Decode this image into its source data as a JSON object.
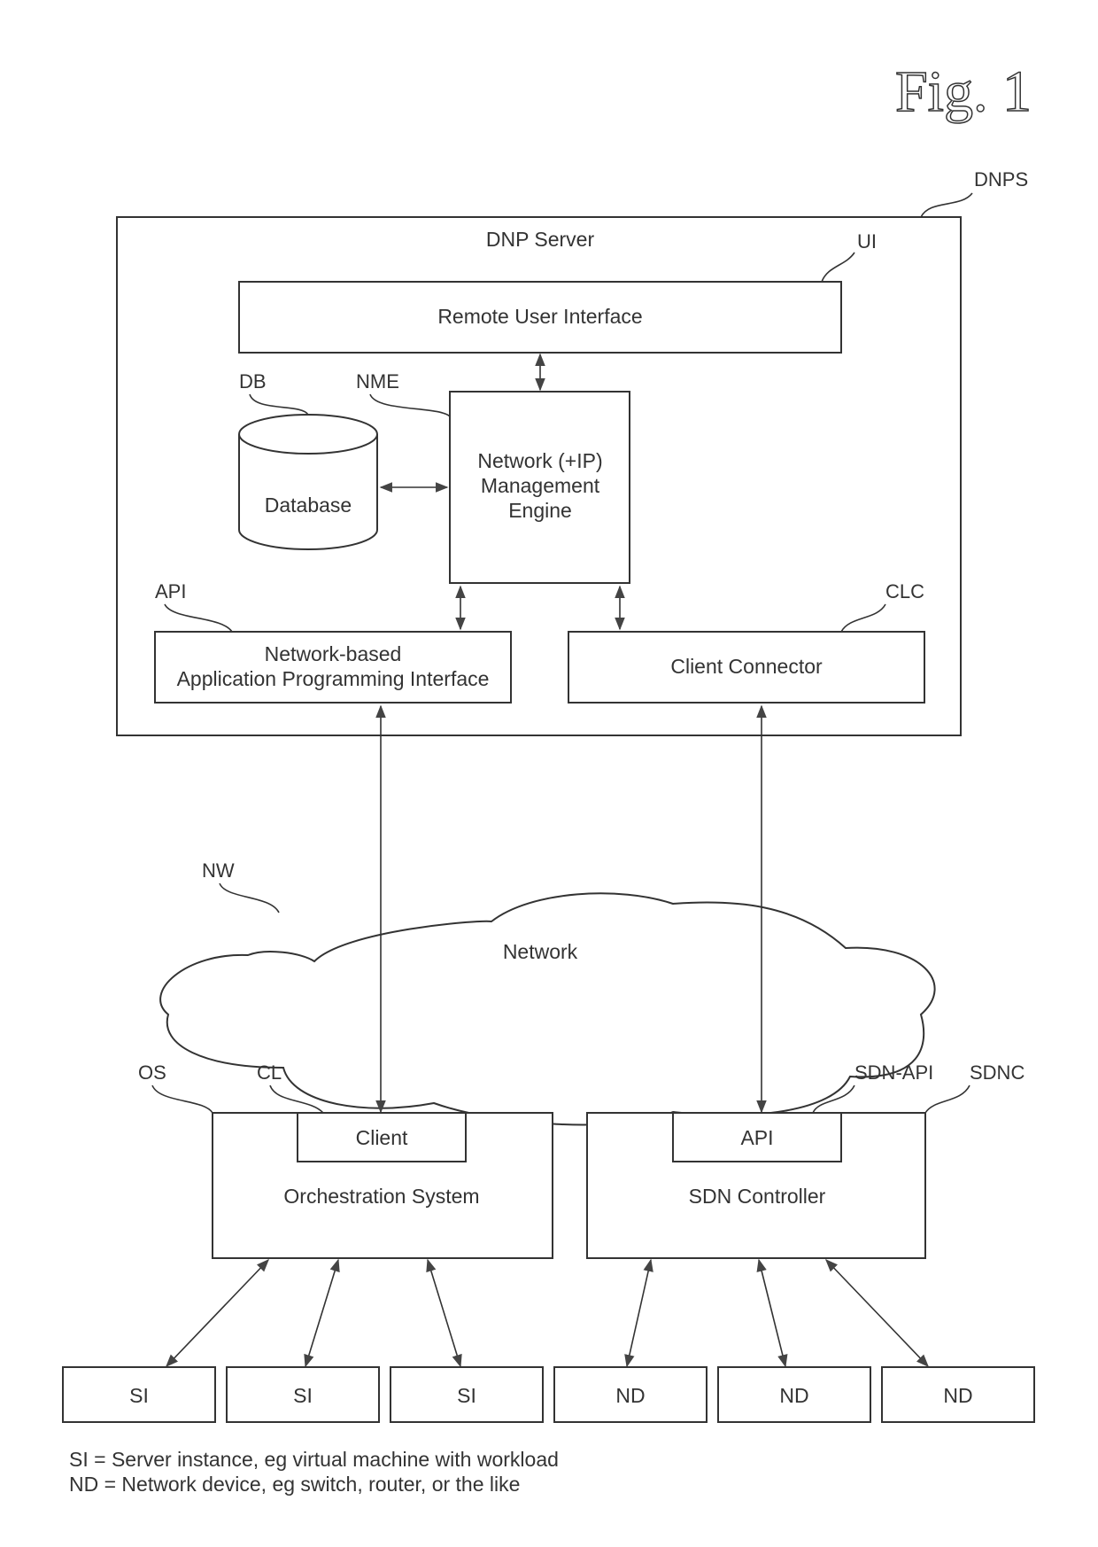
{
  "figure_title": "Fig. 1",
  "dnp_server": {
    "ref": "DNPS",
    "title": "DNP Server",
    "remote_ui": {
      "ref": "UI",
      "label": "Remote User Interface"
    },
    "database": {
      "ref": "DB",
      "label": "Database"
    },
    "engine": {
      "ref": "NME",
      "lines": [
        "Network (+IP)",
        "Management",
        "Engine"
      ]
    },
    "api": {
      "ref": "API",
      "lines": [
        "Network-based",
        "Application Programming Interface"
      ]
    },
    "client_connector": {
      "ref": "CLC",
      "label": "Client Connector"
    }
  },
  "network": {
    "ref": "NW",
    "label": "Network"
  },
  "orchestration": {
    "ref": "OS",
    "label": "Orchestration System",
    "client": {
      "ref": "CL",
      "label": "Client"
    }
  },
  "sdn_controller": {
    "ref": "SDNC",
    "label": "SDN Controller",
    "api": {
      "ref": "SDN-API",
      "label": "API"
    }
  },
  "endpoints": [
    {
      "label": "SI"
    },
    {
      "label": "SI"
    },
    {
      "label": "SI"
    },
    {
      "label": "ND"
    },
    {
      "label": "ND"
    },
    {
      "label": "ND"
    }
  ],
  "legend": [
    "SI = Server instance, eg virtual machine with workload",
    "ND = Network device, eg switch, router, or the like"
  ]
}
